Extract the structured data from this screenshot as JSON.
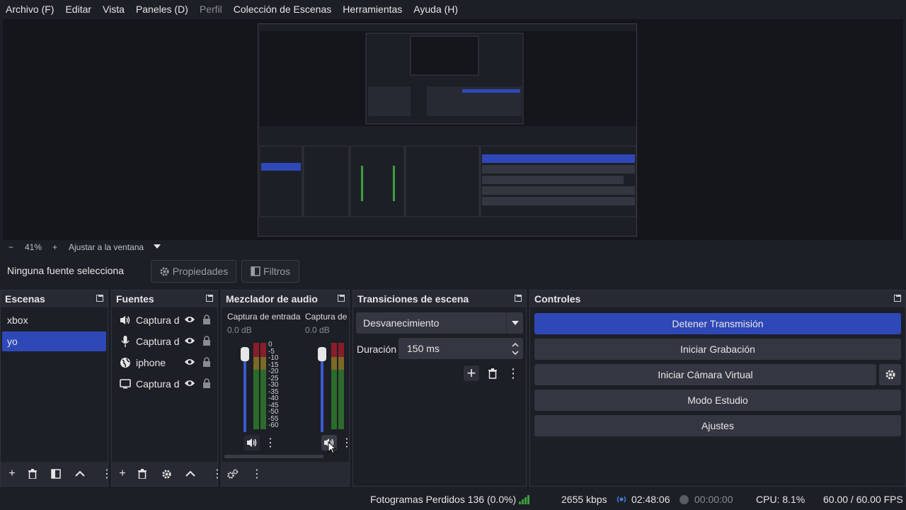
{
  "menu": {
    "items": [
      {
        "label": "Archivo (F)",
        "disabled": false
      },
      {
        "label": "Editar",
        "disabled": false
      },
      {
        "label": "Vista",
        "disabled": false
      },
      {
        "label": "Paneles (D)",
        "disabled": false
      },
      {
        "label": "Perfil",
        "disabled": true
      },
      {
        "label": "Colección de Escenas",
        "disabled": false
      },
      {
        "label": "Herramientas",
        "disabled": false
      },
      {
        "label": "Ayuda (H)",
        "disabled": false
      }
    ]
  },
  "zoom": {
    "minus": "−",
    "level": "41%",
    "plus": "+",
    "fit": "Ajustar a la ventana"
  },
  "properties_bar": {
    "no_source": "Ninguna fuente selecciona",
    "properties": "Propiedades",
    "filters": "Filtros"
  },
  "scenes": {
    "title": "Escenas",
    "items": [
      {
        "label": "xbox",
        "selected": false
      },
      {
        "label": "yo",
        "selected": true
      }
    ]
  },
  "sources": {
    "title": "Fuentes",
    "items": [
      {
        "label": "Captura d",
        "icon": "speaker-icon"
      },
      {
        "label": "Captura d",
        "icon": "microphone-icon"
      },
      {
        "label": "iphone",
        "icon": "globe-icon"
      },
      {
        "label": "Captura d",
        "icon": "monitor-icon"
      }
    ]
  },
  "mixer": {
    "title": "Mezclador de audio",
    "channels": [
      {
        "name": "Captura de entrada",
        "db": "0.0 dB"
      },
      {
        "name": "Captura de s",
        "db": "0.0 dB"
      }
    ],
    "scale": [
      "0",
      "-5",
      "-10",
      "-15",
      "-20",
      "-25",
      "-30",
      "-35",
      "-40",
      "-45",
      "-50",
      "-55",
      "-60"
    ]
  },
  "transitions": {
    "title": "Transiciones de escena",
    "selected": "Desvanecimiento",
    "duration_label": "Duración",
    "duration_value": "150 ms"
  },
  "controls": {
    "title": "Controles",
    "buttons": {
      "stream": "Detener Transmisión",
      "record": "Iniciar Grabación",
      "virtualcam": "Iniciar Cámara Virtual",
      "studio": "Modo Estudio",
      "settings": "Ajustes"
    }
  },
  "status": {
    "dropped_frames": "Fotogramas Perdidos 136 (0.0%)",
    "bitrate": "2655 kbps",
    "stream_time": "02:48:06",
    "record_time": "00:00:00",
    "cpu": "CPU: 8.1%",
    "fps": "60.00 / 60.00 FPS"
  },
  "colors": {
    "accent": "#2f48b8",
    "meter_green": "#3f9e3f",
    "meter_yellow": "#b59a2a",
    "meter_red": "#8a1d2b",
    "live": "#3f82e0"
  }
}
